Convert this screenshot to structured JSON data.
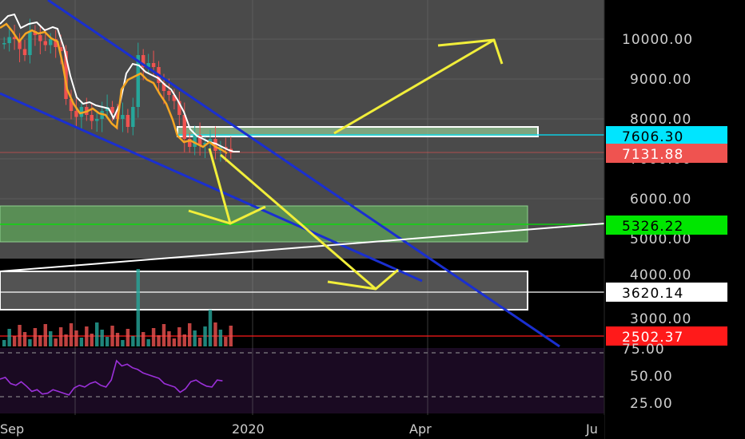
{
  "chart_data": {
    "type": "candlestick",
    "price_axis": {
      "ticks": [
        "10000.00",
        "9000.00",
        "8000.00",
        "7000.00",
        "6000.00",
        "5000.00",
        "4000.00",
        "3000.00"
      ],
      "tick_values": [
        10000,
        9000,
        8000,
        7000,
        6000,
        5000,
        4000,
        3000
      ]
    },
    "indicator_axis": {
      "ticks": [
        "75.00",
        "50.00",
        "25.00"
      ],
      "tick_values": [
        75,
        50,
        25
      ]
    },
    "time_axis": {
      "labels": [
        "Sep",
        "2020",
        "Apr",
        "Ju"
      ]
    },
    "price_tags": [
      {
        "label": "7606.30",
        "value": 7606.3,
        "bg": "#00e5ff",
        "fg": "#000000"
      },
      {
        "label": "7131.88",
        "value": 7131.88,
        "bg": "#ef5350",
        "fg": "#ffffff"
      },
      {
        "label": "5326.22",
        "value": 5326.22,
        "bg": "#00e600",
        "fg": "#000000"
      },
      {
        "label": "3620.14",
        "value": 3620.14,
        "bg": "#ffffff",
        "fg": "#000000"
      },
      {
        "label": "2502.37",
        "value": 2502.37,
        "bg": "#ff1a1a",
        "fg": "#ffffff"
      }
    ],
    "zones": [
      {
        "name": "resistance-zone",
        "from": 7500,
        "to": 7760,
        "color": "#9ad49a"
      },
      {
        "name": "support-zone",
        "from": 4920,
        "to": 5810,
        "color": "#5fa55a"
      },
      {
        "name": "lower-zone",
        "from": 3200,
        "to": 4110,
        "color": "#8a8a8a"
      }
    ],
    "price_series_close": [
      9900,
      10050,
      10000,
      9750,
      9600,
      10200,
      10100,
      9950,
      9850,
      10000,
      9800,
      9700,
      8500,
      8200,
      8050,
      8300,
      8100,
      7950,
      8000,
      8200,
      8300,
      8150,
      8000,
      8100,
      7800,
      8300,
      9600,
      9300,
      9400,
      9300,
      8900,
      8700,
      8600,
      8450,
      8100,
      7500,
      7300,
      7600,
      7350,
      7400,
      7500,
      7200,
      7300,
      7250,
      7150
    ],
    "rsi_series": [
      45,
      47,
      40,
      38,
      42,
      37,
      31,
      33,
      28,
      29,
      33,
      31,
      29,
      27,
      35,
      38,
      36,
      40,
      42,
      38,
      36,
      44,
      66,
      60,
      62,
      58,
      56,
      52,
      50,
      48,
      46,
      40,
      38,
      36,
      30,
      34,
      42,
      44,
      40,
      37,
      36,
      44,
      43
    ]
  }
}
